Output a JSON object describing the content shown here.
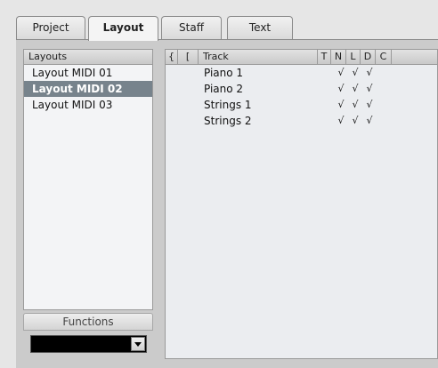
{
  "tabs": [
    {
      "label": "Project",
      "active": false
    },
    {
      "label": "Layout",
      "active": true
    },
    {
      "label": "Staff",
      "active": false
    },
    {
      "label": "Text",
      "active": false
    }
  ],
  "layouts": {
    "header": "Layouts",
    "items": [
      "Layout MIDI 01",
      "Layout MIDI 02",
      "Layout MIDI 03"
    ],
    "selected_index": 1
  },
  "functions": {
    "label": "Functions",
    "selected_value": ""
  },
  "tracks": {
    "columns": [
      "{",
      "[",
      "Track",
      "T",
      "N",
      "L",
      "D",
      "C"
    ],
    "rows": [
      {
        "name": "Piano 1",
        "T": "",
        "N": "√",
        "L": "√",
        "D": "√",
        "C": ""
      },
      {
        "name": "Piano 2",
        "T": "",
        "N": "√",
        "L": "√",
        "D": "√",
        "C": ""
      },
      {
        "name": "Strings 1",
        "T": "",
        "N": "√",
        "L": "√",
        "D": "√",
        "C": ""
      },
      {
        "name": "Strings 2",
        "T": "",
        "N": "√",
        "L": "√",
        "D": "√",
        "C": ""
      }
    ]
  },
  "colors": {
    "selection": "#77838c",
    "panel_background": "#cbcbcb",
    "list_background": "#f3f4f6"
  }
}
